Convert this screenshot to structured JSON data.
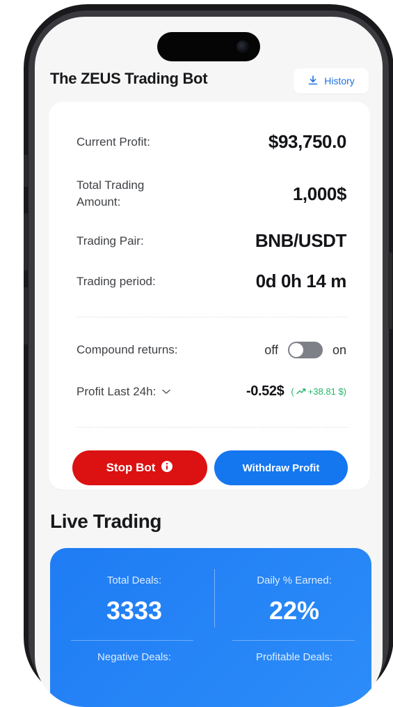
{
  "header": {
    "title": "The ZEUS Trading Bot",
    "history_label": "History"
  },
  "bot": {
    "current_profit_label": "Current Profit:",
    "current_profit_value": "$93,750.0",
    "trading_amount_label_line1": "Total Trading",
    "trading_amount_label_line2": "Amount:",
    "trading_amount_value": "1,000$",
    "trading_pair_label": "Trading Pair:",
    "trading_pair_value": "BNB/USDT",
    "trading_period_label": "Trading period:",
    "trading_period_value": "0d 0h 14 m",
    "compound_label": "Compound returns:",
    "compound_off": "off",
    "compound_on": "on",
    "compound_enabled": false,
    "profit24_label": "Profit Last 24h:",
    "profit24_value": "-0.52$",
    "profit24_change": "+38.81 $)",
    "profit24_open_paren": "(",
    "stop_label": "Stop Bot",
    "withdraw_label": "Withdraw Profit"
  },
  "live_trading": {
    "title": "Live Trading",
    "total_deals_label": "Total Deals:",
    "total_deals_value": "3333",
    "daily_earned_label": "Daily % Earned:",
    "daily_earned_value": "22%",
    "negative_deals_label": "Negative Deals:",
    "profitable_deals_label": "Profitable Deals:"
  },
  "colors": {
    "stop_button": "#dc1111",
    "withdraw_button": "#1577f0",
    "stats_card": "#1f7cf4",
    "positive_change": "#22b567",
    "history_text": "#1f6fe0"
  },
  "icons": {
    "history": "download-icon",
    "stop_info": "info-icon",
    "dropdown": "chevron-down-icon",
    "trend": "trend-up-icon"
  }
}
